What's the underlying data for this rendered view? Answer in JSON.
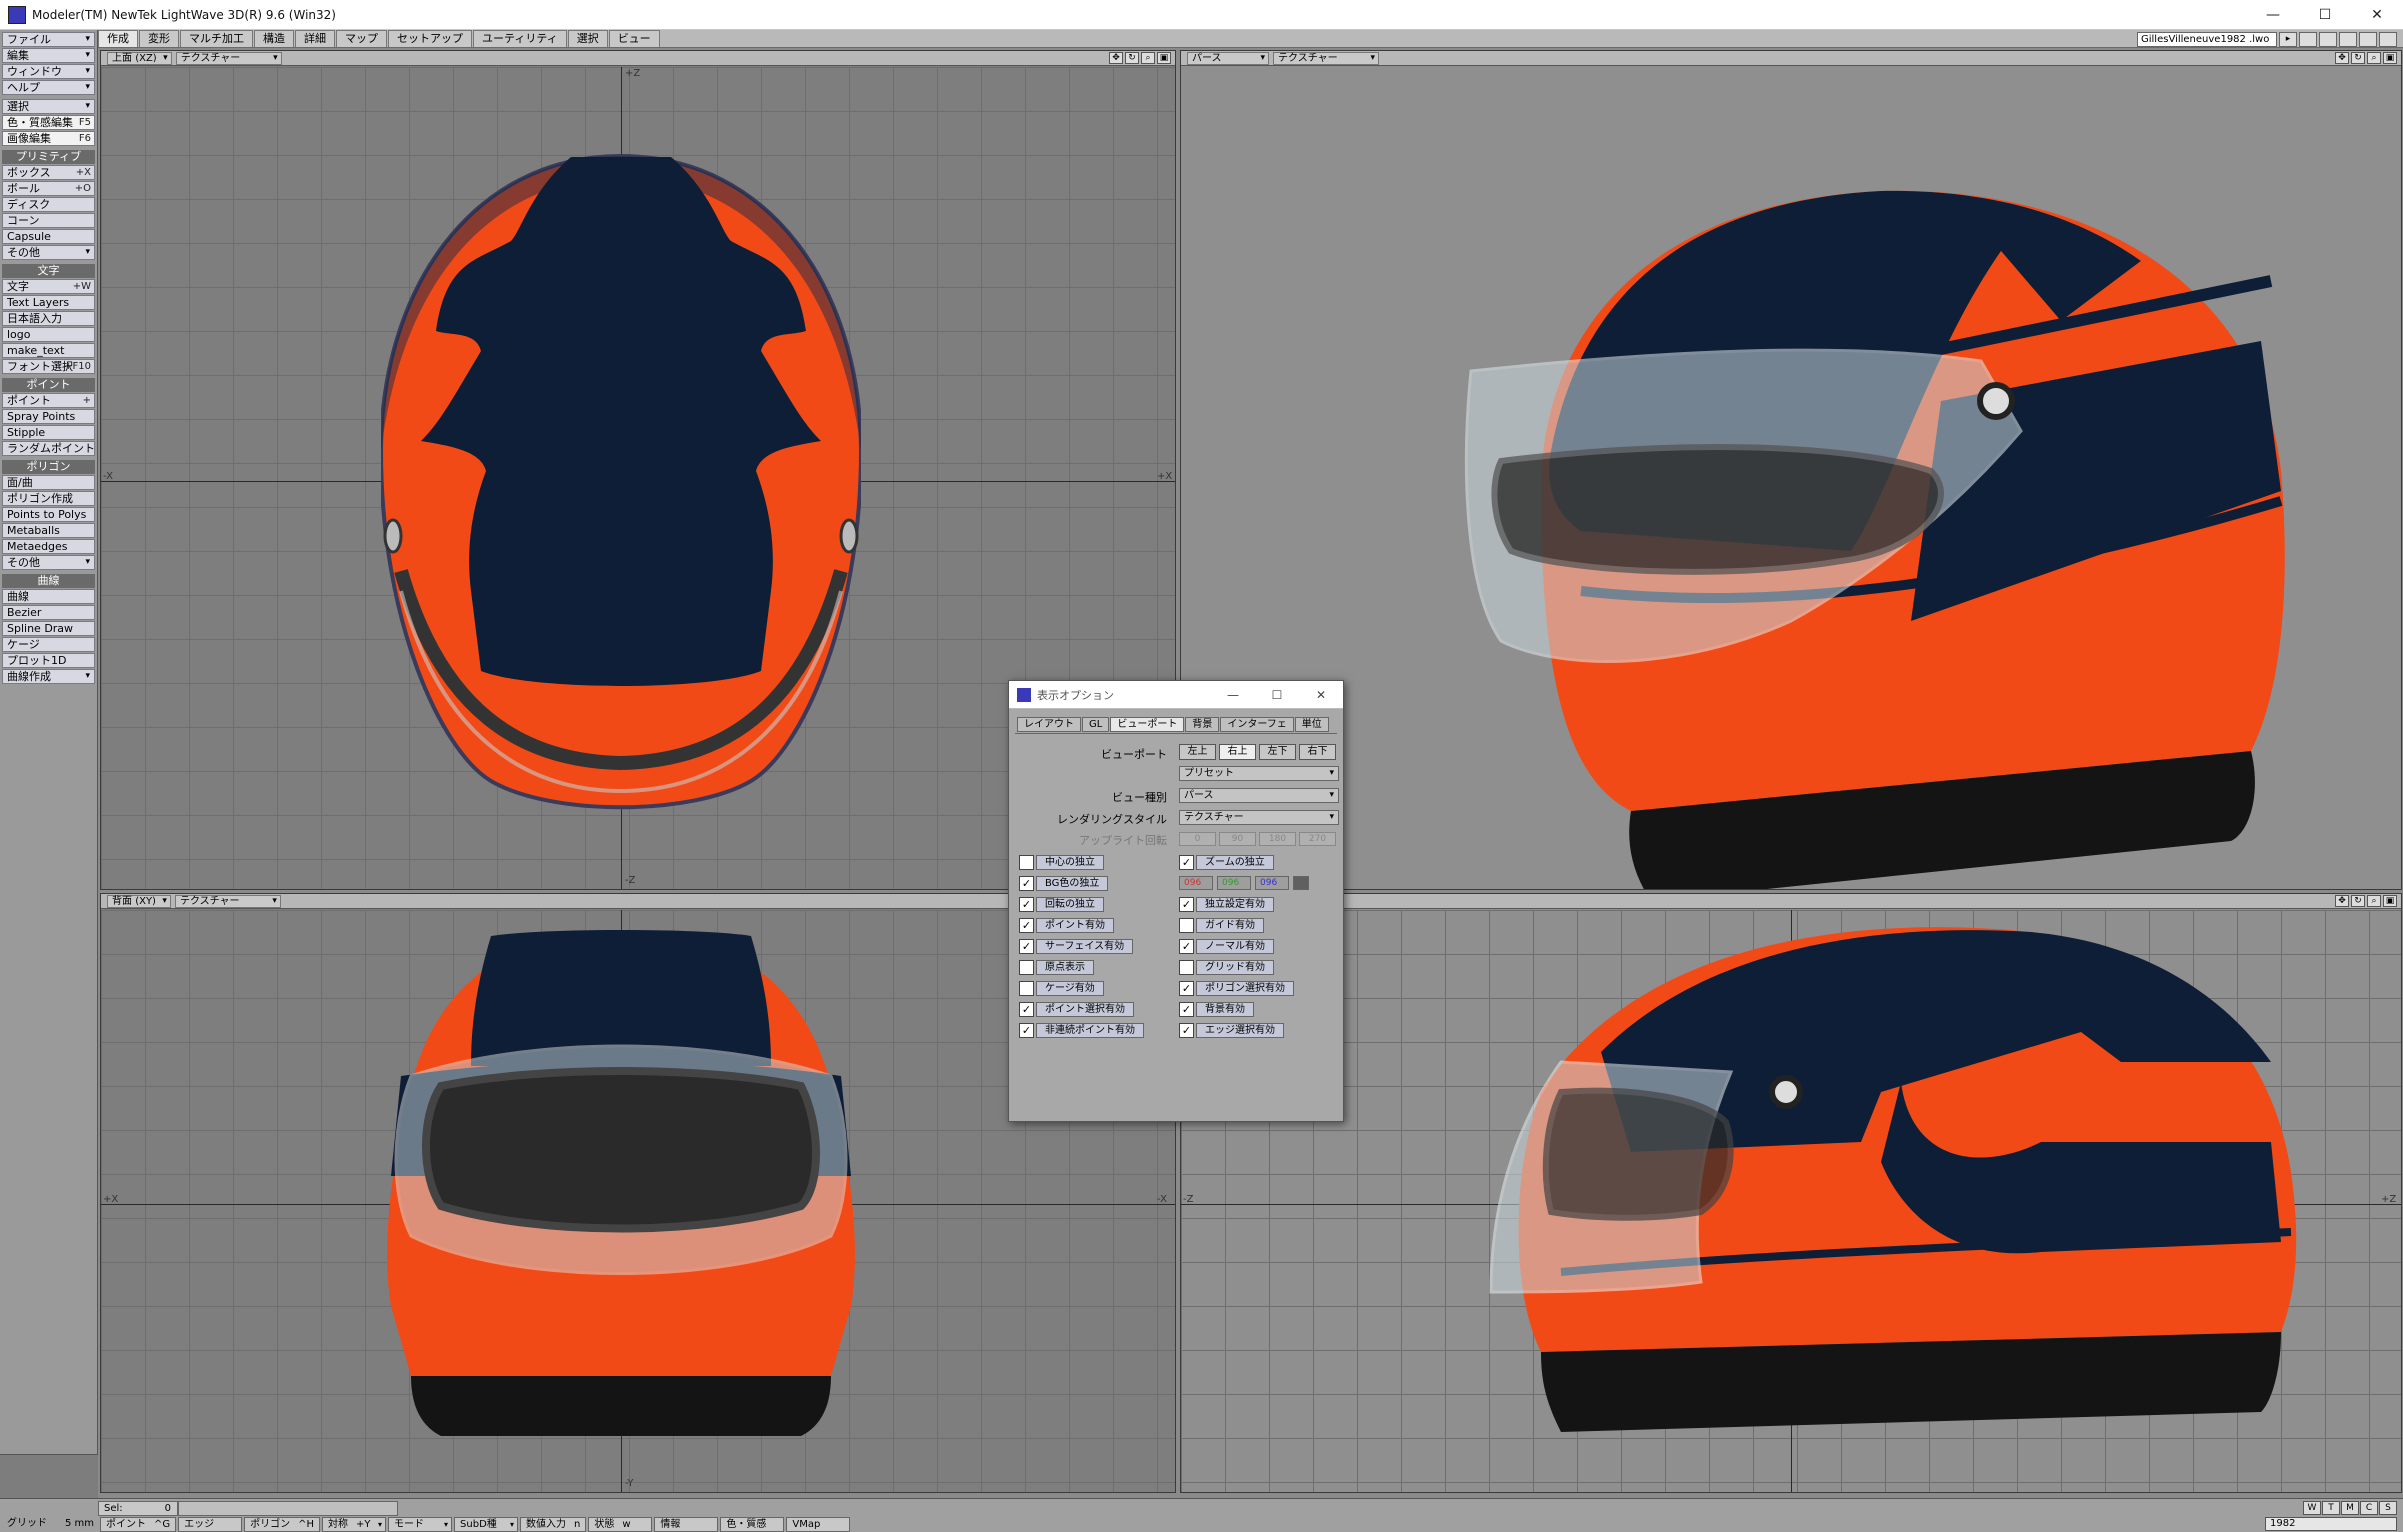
{
  "window": {
    "title": "Modeler(TM) NewTek LightWave 3D(R) 9.6  (Win32)"
  },
  "window_controls": {
    "minimize": "—",
    "maximize": "☐",
    "close": "✕"
  },
  "menu_tabs": [
    "作成",
    "変形",
    "マルチ加工",
    "構造",
    "詳細",
    "マップ",
    "セットアップ",
    "ユーティリティ",
    "選択",
    "ビュー"
  ],
  "scene_name": "GillesVilleneuve1982 .lwo",
  "sidebar": {
    "menus": [
      {
        "label": "ファイル"
      },
      {
        "label": "編集"
      },
      {
        "label": "ウィンドウ"
      },
      {
        "label": "ヘルプ"
      }
    ],
    "select": {
      "label": "選択"
    },
    "quick": [
      {
        "label": "色・質感編集",
        "key": "F5"
      },
      {
        "label": "画像編集",
        "key": "F6"
      }
    ],
    "groups": [
      {
        "header": "プリミティブ",
        "items": [
          {
            "label": "ボックス",
            "key": "+X"
          },
          {
            "label": "ボール",
            "key": "+O"
          },
          {
            "label": "ディスク"
          },
          {
            "label": "コーン"
          },
          {
            "label": "Capsule"
          },
          {
            "label": "その他",
            "dd": true
          }
        ]
      },
      {
        "header": "文字",
        "items": [
          {
            "label": "文字",
            "key": "+W"
          },
          {
            "label": "Text Layers"
          },
          {
            "label": "日本語入力"
          },
          {
            "label": "logo"
          },
          {
            "label": "make_text"
          },
          {
            "label": "フォント選択",
            "key": "+F10"
          }
        ]
      },
      {
        "header": "ポイント",
        "items": [
          {
            "label": "ポイント",
            "key": "+"
          },
          {
            "label": "Spray Points"
          },
          {
            "label": "Stipple"
          },
          {
            "label": "ランダムポイント"
          }
        ]
      },
      {
        "header": "ポリゴン",
        "items": [
          {
            "label": "面/曲"
          },
          {
            "label": "ポリゴン作成"
          },
          {
            "label": "Points to Polys"
          },
          {
            "label": "Metaballs"
          },
          {
            "label": "Metaedges"
          },
          {
            "label": "その他",
            "dd": true
          }
        ]
      },
      {
        "header": "曲線",
        "items": [
          {
            "label": "曲線"
          },
          {
            "label": "Bezier"
          },
          {
            "label": "Spline Draw"
          },
          {
            "label": "ケージ"
          },
          {
            "label": "プロット1D"
          },
          {
            "label": "曲線作成",
            "dd": true
          }
        ]
      }
    ]
  },
  "viewports": {
    "top_left": {
      "view": "上面",
      "axes": "(XZ)",
      "shading": "テクスチャー",
      "axis_top": "+Z",
      "axis_bottom": "-Z",
      "axis_left": "-X",
      "axis_right": "+X"
    },
    "top_right": {
      "view": "パース",
      "shading": "テクスチャー"
    },
    "bottom_left": {
      "view": "背面",
      "axes": "(XY)",
      "shading": "テクスチャー",
      "axis_left": "+X",
      "axis_right": "-X",
      "axis_bottom": "-Y"
    },
    "bottom_right": {
      "axis_left": "-Z",
      "axis_right": "+Z",
      "axis_bottom": "-Y"
    }
  },
  "helmet_colors": {
    "orange": "#f24a16",
    "navy": "#0e1e36",
    "black": "#141414",
    "visor": "#c8d6dc"
  },
  "dialog": {
    "title": "表示オプション",
    "tabs": [
      "レイアウト",
      "GL",
      "ビューポート",
      "背景",
      "インターフェ",
      "単位"
    ],
    "active_tab": "ビューポート",
    "viewport_label": "ビューポート",
    "viewport_buttons": [
      "左上",
      "右上",
      "左下",
      "右下"
    ],
    "active_viewport": "右上",
    "preset": "プリセット",
    "view_type_label": "ビュー種別",
    "view_type": "パース",
    "render_style_label": "レンダリングスタイル",
    "render_style": "テクスチャー",
    "upright_label": "アップライト回転",
    "upright_values": [
      "0",
      "90",
      "180",
      "270"
    ],
    "bg_rgb": [
      "096",
      "096",
      "096"
    ],
    "left_checks": [
      {
        "label": "中心の独立",
        "checked": false
      },
      {
        "label": "BG色の独立",
        "checked": true
      },
      {
        "label": "回転の独立",
        "checked": true
      },
      {
        "label": "ポイント有効",
        "checked": true
      },
      {
        "label": "サーフェイス有効",
        "checked": true
      },
      {
        "label": "原点表示",
        "checked": false
      },
      {
        "label": "ケージ有効",
        "checked": false
      },
      {
        "label": "ポイント選択有効",
        "checked": true
      },
      {
        "label": "非連続ポイント有効",
        "checked": true
      }
    ],
    "right_checks": [
      {
        "label": "ズームの独立",
        "checked": true
      },
      {
        "label": "独立設定有効",
        "checked": true
      },
      {
        "label": "ガイド有効",
        "checked": false
      },
      {
        "label": "ノーマル有効",
        "checked": true
      },
      {
        "label": "グリッド有効",
        "checked": false
      },
      {
        "label": "ポリゴン選択有効",
        "checked": true
      },
      {
        "label": "背景有効",
        "checked": true
      },
      {
        "label": "エッジ選択有効",
        "checked": true
      }
    ]
  },
  "statusbar": {
    "sel_label": "Sel:",
    "sel_value": "0",
    "grid_label": "グリッド",
    "grid_value": "5 mm",
    "cells": [
      {
        "label": "ポイント",
        "key": "^G"
      },
      {
        "label": "エッジ"
      },
      {
        "label": "ポリゴン",
        "key": "^H"
      },
      {
        "label": "対称",
        "key": "+Y",
        "dd": true
      },
      {
        "label": "モード",
        "dd": true
      },
      {
        "label": "SubD種",
        "dd": true
      },
      {
        "label": "数値入力",
        "key": "n"
      },
      {
        "label": "状態",
        "key": "w"
      },
      {
        "label": "情報"
      },
      {
        "label": "色・質感"
      },
      {
        "label": "VMap"
      }
    ],
    "layer_buttons": [
      "W",
      "T",
      "M",
      "C",
      "S"
    ],
    "layer_name": "1982"
  }
}
